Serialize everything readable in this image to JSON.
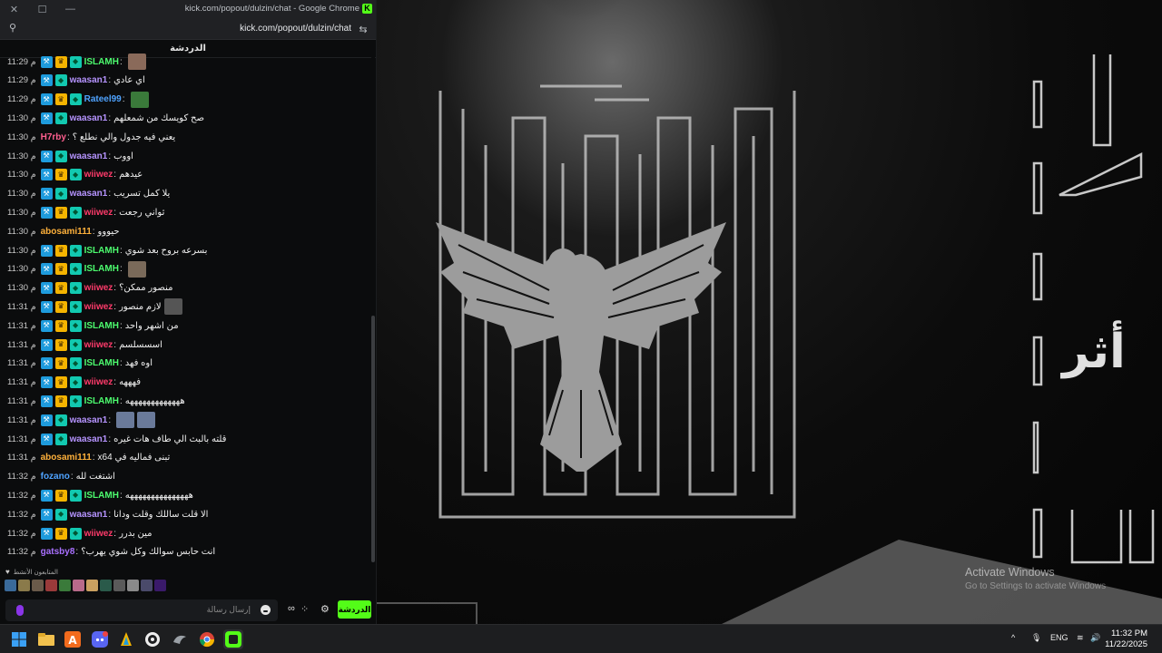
{
  "window": {
    "title": "kick.com/popout/dulzin/chat - Google Chrome",
    "url": "kick.com/popout/dulzin/chat",
    "controls": {
      "close": "✕",
      "maximize": "☐",
      "minimize": "—"
    }
  },
  "chat": {
    "header": "الدردشة",
    "messages": [
      {
        "time": "11:29 م",
        "badges": [
          "mod",
          "sub",
          "vip"
        ],
        "user": "ISLAMH",
        "color": "#4cfb6e",
        "text": "",
        "emotes": [
          "#8a6a5a"
        ]
      },
      {
        "time": "11:29 م",
        "badges": [
          "mod",
          "vip"
        ],
        "user": "waasan1",
        "color": "#b694ff",
        "text": "اي عادي",
        "emotes": []
      },
      {
        "time": "11:29 م",
        "badges": [
          "mod",
          "sub",
          "vip"
        ],
        "user": "Rateel99",
        "color": "#4fa3ff",
        "text": "",
        "emotes": [
          "#3a7a3a"
        ]
      },
      {
        "time": "11:30 م",
        "badges": [
          "mod",
          "vip"
        ],
        "user": "waasan1",
        "color": "#b694ff",
        "text": "صح كويسك من شمعلهم",
        "emotes": []
      },
      {
        "time": "11:30 م",
        "badges": [],
        "user": "H7rby",
        "color": "#ff5f8f",
        "text": "يعني فيه جدول والي نطلع ؟",
        "emotes": []
      },
      {
        "time": "11:30 م",
        "badges": [
          "mod",
          "vip"
        ],
        "user": "waasan1",
        "color": "#b694ff",
        "text": "اووب",
        "emotes": []
      },
      {
        "time": "11:30 م",
        "badges": [
          "mod",
          "sub",
          "vip"
        ],
        "user": "wiiwez",
        "color": "#ff3b6b",
        "text": "عيدهم",
        "emotes": []
      },
      {
        "time": "11:30 م",
        "badges": [
          "mod",
          "vip"
        ],
        "user": "waasan1",
        "color": "#b694ff",
        "text": "يلا كمل تسريب",
        "emotes": []
      },
      {
        "time": "11:30 م",
        "badges": [
          "mod",
          "sub",
          "vip"
        ],
        "user": "wiiwez",
        "color": "#ff3b6b",
        "text": "ثواني رجعت",
        "emotes": []
      },
      {
        "time": "11:30 م",
        "badges": [],
        "user": "abosami111",
        "color": "#ffb13b",
        "text": "حيووو",
        "emotes": []
      },
      {
        "time": "11:30 م",
        "badges": [
          "mod",
          "sub",
          "vip"
        ],
        "user": "ISLAMH",
        "color": "#4cfb6e",
        "text": "بسرعه بروح بعد شوي",
        "emotes": []
      },
      {
        "time": "11:30 م",
        "badges": [
          "mod",
          "sub",
          "vip"
        ],
        "user": "ISLAMH",
        "color": "#4cfb6e",
        "text": "",
        "emotes": [
          "#7a6a5a"
        ]
      },
      {
        "time": "11:30 م",
        "badges": [
          "mod",
          "sub",
          "vip"
        ],
        "user": "wiiwez",
        "color": "#ff3b6b",
        "text": "منصور ممكن؟",
        "emotes": []
      },
      {
        "time": "11:31 م",
        "badges": [
          "mod",
          "sub",
          "vip"
        ],
        "user": "wiiwez",
        "color": "#ff3b6b",
        "text": "لازم منصور",
        "emotes": [
          "#555555"
        ]
      },
      {
        "time": "11:31 م",
        "badges": [
          "mod",
          "sub",
          "vip"
        ],
        "user": "ISLAMH",
        "color": "#4cfb6e",
        "text": "من اشهر واحد",
        "emotes": []
      },
      {
        "time": "11:31 م",
        "badges": [
          "mod",
          "sub",
          "vip"
        ],
        "user": "wiiwez",
        "color": "#ff3b6b",
        "text": "اسسسلسم",
        "emotes": []
      },
      {
        "time": "11:31 م",
        "badges": [
          "mod",
          "sub",
          "vip"
        ],
        "user": "ISLAMH",
        "color": "#4cfb6e",
        "text": "اوه فهد",
        "emotes": []
      },
      {
        "time": "11:31 م",
        "badges": [
          "mod",
          "sub",
          "vip"
        ],
        "user": "wiiwez",
        "color": "#ff3b6b",
        "text": "فهههه",
        "emotes": []
      },
      {
        "time": "11:31 م",
        "badges": [
          "mod",
          "sub",
          "vip"
        ],
        "user": "ISLAMH",
        "color": "#4cfb6e",
        "text": "هههههههههههههه",
        "emotes": []
      },
      {
        "time": "11:31 م",
        "badges": [
          "mod",
          "vip"
        ],
        "user": "waasan1",
        "color": "#b694ff",
        "text": "",
        "emotes": [
          "#6a7a9a",
          "#6a7a9a"
        ]
      },
      {
        "time": "11:31 م",
        "badges": [
          "mod",
          "vip"
        ],
        "user": "waasan1",
        "color": "#b694ff",
        "text": "قلته بالبث الي طاف هات غيره",
        "emotes": []
      },
      {
        "time": "11:31 م",
        "badges": [],
        "user": "abosami111",
        "color": "#ffb13b",
        "text": "تبنى فماليه في x64",
        "emotes": []
      },
      {
        "time": "11:32 م",
        "badges": [],
        "user": "fozano",
        "color": "#4fa3ff",
        "text": "اشتغت لله",
        "emotes": []
      },
      {
        "time": "11:32 م",
        "badges": [
          "mod",
          "sub",
          "vip"
        ],
        "user": "ISLAMH",
        "color": "#4cfb6e",
        "text": "هههههههههههههههه",
        "emotes": []
      },
      {
        "time": "11:32 م",
        "badges": [
          "mod",
          "vip"
        ],
        "user": "waasan1",
        "color": "#b694ff",
        "text": "الا قلت ساللك وقلت ودانا",
        "emotes": []
      },
      {
        "time": "11:32 م",
        "badges": [
          "mod",
          "sub",
          "vip"
        ],
        "user": "wiiwez",
        "color": "#ff3b6b",
        "text": "مين بدرر",
        "emotes": []
      },
      {
        "time": "11:32 م",
        "badges": [],
        "user": "gatsby8",
        "color": "#a970ff",
        "text": "انت حابس سوالك وكل شوي يهرب؟",
        "emotes": []
      }
    ],
    "viewers_label": "المتابعون الأنشط",
    "input_placeholder": "إرسال رسالة",
    "send_label": "الدردشة"
  },
  "stream": {
    "watermark_title": "Activate Windows",
    "watermark_sub": "Go to Settings to activate Windows",
    "arabic_title": "أثر"
  },
  "taskbar": {
    "lang": "ENG",
    "time": "11:32 PM",
    "date": "11/22/2025"
  },
  "colors": {
    "kick_green": "#53fc18",
    "mod": "#1e9bdc",
    "sub": "#f5b400",
    "vip": "#12c9b0"
  }
}
